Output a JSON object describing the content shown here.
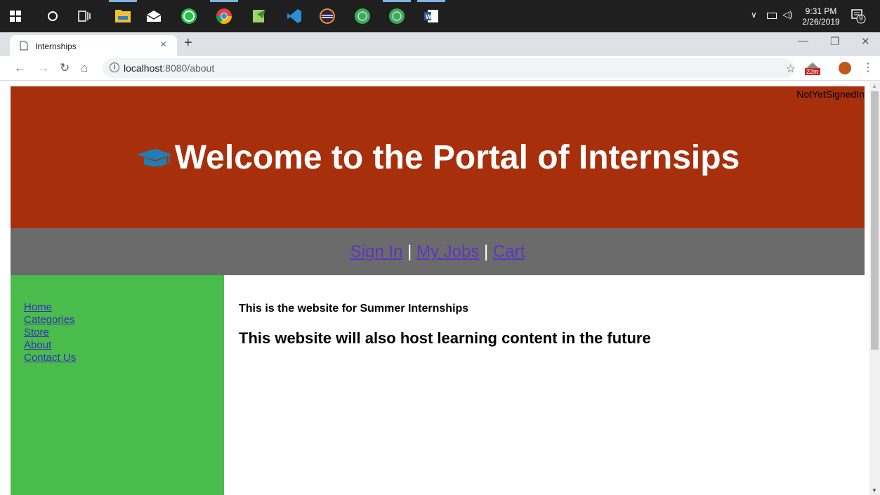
{
  "taskbar": {
    "time": "9:31 PM",
    "date": "2/26/2019",
    "notification_count": "9",
    "apps": [
      "start-icon",
      "cortana-icon",
      "task-view-icon",
      "file-explorer-icon",
      "mail-icon",
      "whatsapp-icon",
      "chrome-icon",
      "notepad-icon",
      "vscode-icon",
      "eclipse-icon",
      "app-icon",
      "app-icon",
      "word-icon"
    ]
  },
  "browser": {
    "tab_title": "Internships",
    "url_host": "localhost",
    "url_path": ":8080/about",
    "extension_badge": "22m"
  },
  "page": {
    "signin_status": "NotYetSignedIn",
    "title": "Welcome to the Portal of Internsips",
    "nav": {
      "sign_in": "Sign In",
      "separator": "|",
      "my_jobs": "My Jobs",
      "cart": "Cart"
    },
    "sidebar": [
      {
        "label": "Home"
      },
      {
        "label": "Categories"
      },
      {
        "label": "Store"
      },
      {
        "label": "About"
      },
      {
        "label": "Contact Us"
      }
    ],
    "main": {
      "line1": "This is the website for Summer Internships",
      "line2": "This website will also host learning content in the future"
    }
  },
  "colors": {
    "header_bg": "#a82f0b",
    "nav_bg": "#6b6b6b",
    "sidebar_bg": "#49bc4c",
    "link": "#5d35c2",
    "cap_icon": "#1f7fb5"
  }
}
